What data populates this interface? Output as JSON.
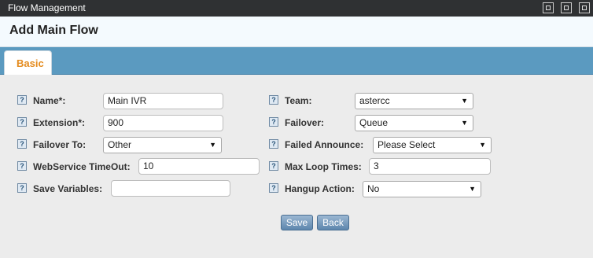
{
  "window": {
    "title": "Flow Management"
  },
  "page": {
    "heading": "Add Main Flow"
  },
  "tabs": [
    {
      "label": "Basic",
      "active": true
    }
  ],
  "help_icon_glyph": "?",
  "dropdown_arrow": "▼",
  "form": {
    "name": {
      "label": "Name*:",
      "value": "Main IVR"
    },
    "extension": {
      "label": "Extension*:",
      "value": "900"
    },
    "failover_to": {
      "label": "Failover To:",
      "value": "Other"
    },
    "webservice_timeout": {
      "label": "WebService TimeOut:",
      "value": "10"
    },
    "save_variables": {
      "label": "Save Variables:",
      "value": ""
    },
    "team": {
      "label": "Team:",
      "value": "astercc"
    },
    "failover": {
      "label": "Failover:",
      "value": "Queue"
    },
    "failed_announce": {
      "label": "Failed Announce:",
      "value": "Please Select"
    },
    "max_loop_times": {
      "label": "Max Loop Times:",
      "value": "3"
    },
    "hangup_action": {
      "label": "Hangup Action:",
      "value": "No"
    }
  },
  "buttons": {
    "save": "Save",
    "back": "Back"
  },
  "colors": {
    "titlebar": "#2f3133",
    "tabbar": "#5b9ac0",
    "tab_text": "#e48a1c",
    "button": "#5d86ad"
  }
}
